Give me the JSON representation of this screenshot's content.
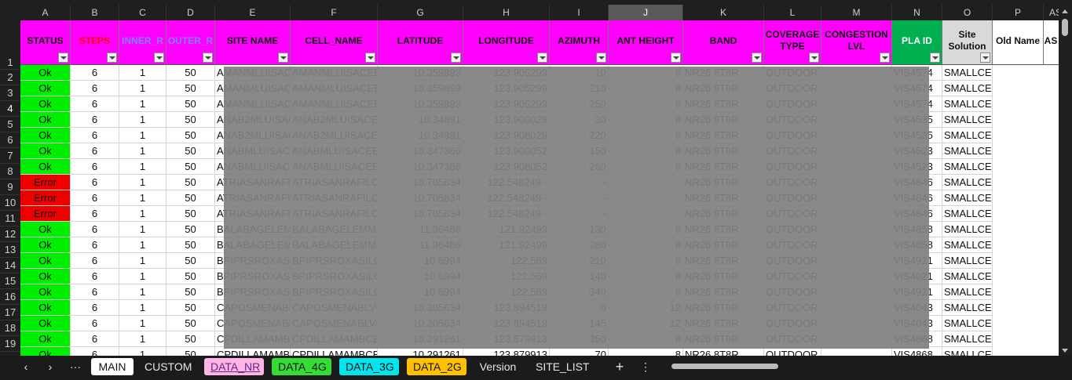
{
  "columns": [
    "A",
    "B",
    "C",
    "D",
    "E",
    "F",
    "G",
    "H",
    "I",
    "J",
    "K",
    "L",
    "M",
    "N",
    "O",
    "P",
    "AS"
  ],
  "rows": [
    "1",
    "2",
    "3",
    "4",
    "5",
    "6",
    "7",
    "8",
    "9",
    "10",
    "11",
    "12",
    "13",
    "14",
    "15",
    "16",
    "17",
    "18",
    "19",
    "20"
  ],
  "headers": [
    {
      "label": "STATUS",
      "bg": "#ff00ff",
      "color": "#111111"
    },
    {
      "label": "STEPS",
      "bg": "#ff00ff",
      "color": "#ff0000"
    },
    {
      "label": "INNER_R",
      "bg": "#ff00ff",
      "color": "#8080ff"
    },
    {
      "label": "OUTER_R",
      "bg": "#ff00ff",
      "color": "#8080ff"
    },
    {
      "label": "SITE NAME",
      "bg": "#ff00ff",
      "color": "#111111"
    },
    {
      "label": "CELL_NAME",
      "bg": "#ff00ff",
      "color": "#111111"
    },
    {
      "label": "LATITUDE",
      "bg": "#ff00ff",
      "color": "#111111"
    },
    {
      "label": "LONGITUDE",
      "bg": "#ff00ff",
      "color": "#111111"
    },
    {
      "label": "AZIMUTH",
      "bg": "#ff00ff",
      "color": "#111111"
    },
    {
      "label": "ANT HEIGHT",
      "bg": "#ff00ff",
      "color": "#111111"
    },
    {
      "label": "BAND",
      "bg": "#ff00ff",
      "color": "#111111"
    },
    {
      "label": "COVERAGE TYPE",
      "bg": "#ff00ff",
      "color": "#111111"
    },
    {
      "label": "CONGESTION LVL",
      "bg": "#ff00ff",
      "color": "#111111"
    },
    {
      "label": "PLA ID",
      "bg": "#00b050",
      "color": "#ffffff"
    },
    {
      "label": "Site Solution",
      "bg": "#d9d9d9",
      "color": "#111111"
    },
    {
      "label": "Old Name",
      "bg": "#ffffff",
      "color": "#111111"
    },
    {
      "label": "AS D",
      "bg": "#ffffff",
      "color": "#111111"
    }
  ],
  "data": [
    [
      "Ok",
      "6",
      "1",
      "50",
      "AMANMLUISAC",
      "AMANMLUISACEE",
      "10.359893",
      "123.905299",
      "10",
      "8",
      "NR26 8T8R",
      "OUTDOOR",
      "",
      "VIS4574",
      "SMALLCELL-EASYMACRO"
    ],
    [
      "Ok",
      "6",
      "1",
      "50",
      "AMANMLUISAC",
      "AMANMLUISACEE",
      "10.359893",
      "123.905299",
      "210",
      "8",
      "NR26 8T8R",
      "OUTDOOR",
      "",
      "VIS4574",
      "SMALLCELL-EASYMACRO"
    ],
    [
      "Ok",
      "6",
      "1",
      "50",
      "AMANMLUISAC",
      "AMANMLUISACEE",
      "10.359893",
      "123.905299",
      "250",
      "8",
      "NR26 8T8R",
      "OUTDOOR",
      "",
      "VIS4574",
      "SMALLCELL-EASYMACRO"
    ],
    [
      "Ok",
      "6",
      "1",
      "50",
      "ANAB2MLUISAC",
      "ANAB2MLUISACEE",
      "10.34891",
      "123.908029",
      "30",
      "8",
      "NR26 8T8R",
      "OUTDOOR",
      "",
      "VIS4535",
      "SMALLCELL-EASYMACRO"
    ],
    [
      "Ok",
      "6",
      "1",
      "50",
      "ANAB2MLUISAC",
      "ANAB2MLUISACEE",
      "10.34891",
      "123.908029",
      "220",
      "8",
      "NR26 8T8R",
      "OUTDOOR",
      "",
      "VIS4535",
      "SMALLCELL-EASYMACRO"
    ],
    [
      "Ok",
      "6",
      "1",
      "50",
      "ANABMLUISACI",
      "ANABMLUISACEEB",
      "10.347366",
      "123.908052",
      "150",
      "8",
      "NR26 8T8R",
      "OUTDOOR",
      "",
      "VIS4523",
      "SMALLCELL-EASYMACRO"
    ],
    [
      "Ok",
      "6",
      "1",
      "50",
      "ANABMLUISACI",
      "ANABMLUISACEEB",
      "10.347366",
      "123.908052",
      "260",
      "8",
      "NR26 8T8R",
      "OUTDOOR",
      "",
      "VIS4523",
      "SMALLCELL-EASYMACRO"
    ],
    [
      "Error",
      "6",
      "1",
      "50",
      "ATRIASANRAFI",
      "ATRIASANRAFILO",
      "10.705834",
      "122.548249 -",
      "-",
      "",
      "NR26 8T8R",
      "OUTDOOR",
      "",
      "VIS4846",
      "SMALLCELL-EASYMACRO"
    ],
    [
      "Error",
      "6",
      "1",
      "50",
      "ATRIASANRAFI",
      "ATRIASANRAFILO",
      "10.705834",
      "122.548249 -",
      "-",
      "",
      "NR26 8T8R",
      "OUTDOOR",
      "",
      "VIS4846",
      "SMALLCELL-EASYMACRO"
    ],
    [
      "Error",
      "6",
      "1",
      "50",
      "ATRIASANRAFI",
      "ATRIASANRAFILO",
      "10.705834",
      "122.548249 -",
      "-",
      "",
      "NR26 8T8R",
      "OUTDOOR",
      "",
      "VIS4846",
      "SMALLCELL-EASYMACRO"
    ],
    [
      "Ok",
      "6",
      "1",
      "50",
      "BALABAGELEMI",
      "BALABAGELEMMA",
      "11.96486",
      "121.92499",
      "130",
      "8",
      "NR26 8T8R",
      "OUTDOOR",
      "",
      "VIS4858",
      "SMALLCELL-EASYMACRO"
    ],
    [
      "Ok",
      "6",
      "1",
      "50",
      "BALABAGELEMI",
      "BALABAGELEMMA",
      "11.96486",
      "121.92499",
      "280",
      "8",
      "NR26 8T8R",
      "OUTDOOR",
      "",
      "VIS4858",
      "SMALLCELL-EASYMACRO"
    ],
    [
      "Ok",
      "6",
      "1",
      "50",
      "BPIPRSROXASIL",
      "BPIPRSROXASILOI",
      "10.6994",
      "122.569",
      "210",
      "8",
      "NR26 8T8R",
      "OUTDOOR",
      "",
      "VIS4921",
      "SMALLCELL-EASYMACRO"
    ],
    [
      "Ok",
      "6",
      "1",
      "50",
      "BPIPRSROXASIL",
      "BPIPRSROXASILOI",
      "10.6994",
      "122.569",
      "140",
      "8",
      "NR26 8T8R",
      "OUTDOOR",
      "",
      "VIS4921",
      "SMALLCELL-EASYMACRO"
    ],
    [
      "Ok",
      "6",
      "1",
      "50",
      "BPIPRSROXASIL",
      "BPIPRSROXASILOI",
      "10.6994",
      "122.569",
      "340",
      "8",
      "NR26 8T8R",
      "OUTDOOR",
      "",
      "VIS4921",
      "SMALLCELL-EASYMACRO"
    ],
    [
      "Ok",
      "6",
      "1",
      "50",
      "CAPOSMENABL",
      "CAPOSMENABLVG",
      "10.305634",
      "123.894519",
      "0",
      "12",
      "NR26 8T8R",
      "OUTDOOR",
      "",
      "VIS4043",
      "SMALLCELL-EASYMACRO"
    ],
    [
      "Ok",
      "6",
      "1",
      "50",
      "CAPOSMENABL",
      "CAPOSMENABLVG",
      "10.305634",
      "123.894519",
      "145",
      "12",
      "NR26 8T8R",
      "OUTDOOR",
      "",
      "VIS4043",
      "SMALLCELL-EASYMACRO"
    ],
    [
      "Ok",
      "6",
      "1",
      "50",
      "CPDILLAMAMB",
      "CPDILLAMAMBCE",
      "10.291261",
      "123.879913",
      "350",
      "8",
      "NR26 8T8R",
      "OUTDOOR",
      "",
      "VIS4868",
      "SMALLCELL-EASYMACRO"
    ],
    [
      "Ok",
      "6",
      "1",
      "50",
      "CPDILLAMAMB",
      "CPDILLAMAMBCE",
      "10.291261",
      "123.879913",
      "70",
      "8",
      "NR26 8T8R",
      "OUTDOOR",
      "",
      "VIS4868",
      "SMALLCELL-EASYMACRO"
    ]
  ],
  "tabs": [
    "MAIN",
    "CUSTOM",
    "DATA_NR",
    "DATA_4G",
    "DATA_3G",
    "DATA_2G",
    "Version",
    "SITE_LIST"
  ],
  "tab_colors": {
    "MAIN": "#ffffff",
    "CUSTOM": "",
    "DATA_NR": "#ffb3e6",
    "DATA_4G": "#33dd33",
    "DATA_3G": "#00e5ee",
    "DATA_2G": "#ffc000",
    "Version": "",
    "SITE_LIST": ""
  },
  "active_tab": "DATA_NR",
  "nav": {
    "prev": "‹",
    "next": "›",
    "more": "···",
    "add": "+",
    "menu": "⋮"
  },
  "colors": {
    "ok": "#00ee00",
    "error": "#ee0000",
    "overlay": "#808080"
  }
}
